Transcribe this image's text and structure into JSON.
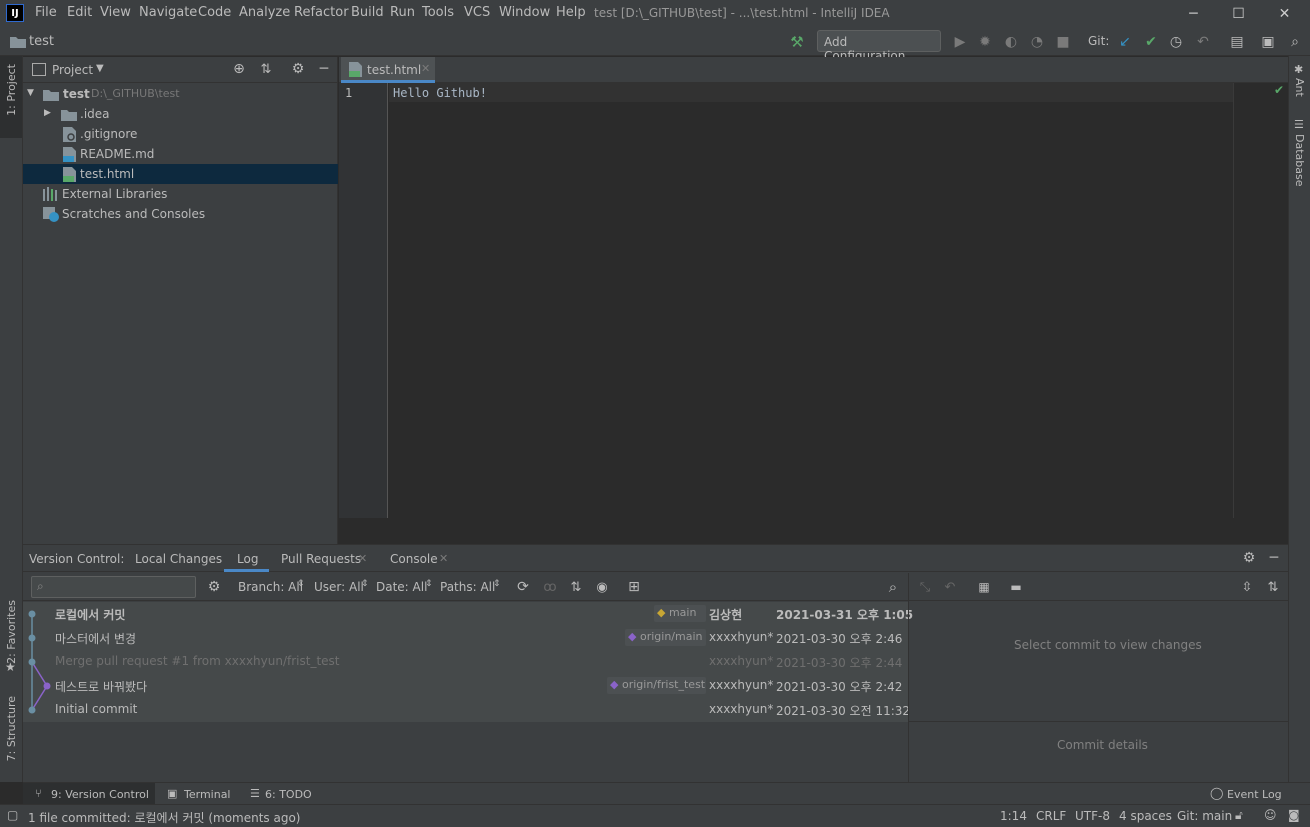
{
  "app": {
    "window_title": "test [D:\\_GITHUB\\test] - ...\\test.html - IntelliJ IDEA",
    "menu": [
      "File",
      "Edit",
      "View",
      "Navigate",
      "Code",
      "Analyze",
      "Refactor",
      "Build",
      "Run",
      "Tools",
      "VCS",
      "Window",
      "Help"
    ]
  },
  "navbar": {
    "project_name": "test",
    "run_config": "Add Configuration...",
    "git_label": "Git:"
  },
  "left_tabs": {
    "project": "1: Project",
    "favorites": "2: Favorites",
    "structure": "7: Structure"
  },
  "right_tabs": {
    "ant": "Ant",
    "database": "Database"
  },
  "project_panel": {
    "title": "Project",
    "root_name": "test",
    "root_path": "D:\\_GITHUB\\test",
    "items": [
      ".idea",
      ".gitignore",
      "README.md",
      "test.html",
      "External Libraries",
      "Scratches and Consoles"
    ]
  },
  "editor": {
    "tab_label": "test.html",
    "line_number": "1",
    "code_line": "Hello Github!"
  },
  "version_control": {
    "tabs": [
      "Version Control:",
      "Local Changes",
      "Log",
      "Pull Requests",
      "Console"
    ],
    "filters": {
      "branch": "Branch: All",
      "user": "User: All",
      "date": "Date: All",
      "paths": "Paths: All"
    },
    "commits": [
      {
        "message": "로컬에서 커밋",
        "tag": "main",
        "author": "김상현",
        "date": "2021-03-31 오후 1:05"
      },
      {
        "message": "마스터에서 변경",
        "tag": "origin/main",
        "author": "xxxxhyun*",
        "date": "2021-03-30 오후 2:46"
      },
      {
        "message": "Merge pull request #1 from xxxxhyun/frist_test",
        "tag": "",
        "author": "xxxxhyun*",
        "date": "2021-03-30 오후 2:44"
      },
      {
        "message": "테스트로 바꿔봤다",
        "tag": "origin/frist_test",
        "author": "xxxxhyun*",
        "date": "2021-03-30 오후 2:42"
      },
      {
        "message": "Initial commit",
        "tag": "",
        "author": "xxxxhyun*",
        "date": "2021-03-30 오전 11:32"
      }
    ],
    "select_commit_text": "Select commit to view changes",
    "commit_details_text": "Commit details"
  },
  "bottom_tabs": {
    "vc": "9: Version Control",
    "terminal": "Terminal",
    "todo": "6: TODO",
    "event_log": "Event Log"
  },
  "statusbar": {
    "message": "1 file committed: 로컬에서 커밋 (moments ago)",
    "position": "1:14",
    "line_sep": "CRLF",
    "encoding": "UTF-8",
    "indent": "4 spaces",
    "git_branch": "Git: main"
  },
  "colors": {
    "accent": "#4a88c7",
    "selection": "#0d293e",
    "graph": "#6a8fa3",
    "graph_merge": "#8a63c9",
    "green": "#59a869"
  }
}
